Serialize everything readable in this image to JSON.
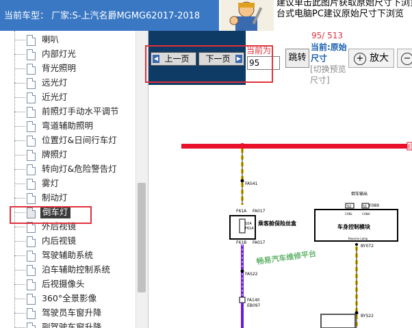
{
  "header": {
    "vehicle_model": "当前车型： 厂家:S-上汽名爵MGMG62017-2018",
    "promo_line1": "建议单击此图片获取原始尺寸下浏览",
    "promo_line2": "台式电脑PC建议原始尺寸下浏览"
  },
  "sidebar": {
    "items": [
      {
        "label": "喇叭"
      },
      {
        "label": "内部灯光"
      },
      {
        "label": "背光照明"
      },
      {
        "label": "远光灯"
      },
      {
        "label": "近光灯"
      },
      {
        "label": "前照灯手动水平调节"
      },
      {
        "label": "弯道辅助照明"
      },
      {
        "label": "位置灯&日间行车灯"
      },
      {
        "label": "牌照灯"
      },
      {
        "label": "转向灯&危险警告灯"
      },
      {
        "label": "雾灯"
      },
      {
        "label": "制动灯"
      },
      {
        "label": "倒车灯"
      },
      {
        "label": "外后视镜"
      },
      {
        "label": "内后视镜"
      },
      {
        "label": "驾驶辅助系统"
      },
      {
        "label": "泊车辅助控制系统"
      },
      {
        "label": "后视摄像头"
      },
      {
        "label": "360°全景影像"
      },
      {
        "label": "驾驶员车窗升降"
      },
      {
        "label": "副驾驶车窗升降"
      }
    ],
    "selected_index": 12
  },
  "toolbar": {
    "prev_label": "上一页",
    "next_label": "下一页",
    "current_page_label": "当前为",
    "current_page_value": "95",
    "jump_label": "跳转",
    "page_count": "95/ 513",
    "size_title": "当前:原始尺寸",
    "size_switch": "[切换预览尺寸]",
    "zoom_in_label": "放大",
    "zoom_in_icon": "zoom-in-icon",
    "zoom_out_icon": "zoom-out-icon"
  },
  "diagram": {
    "labels": {
      "fas41": "FAS41",
      "fa017_top": "FA017",
      "fa017_bottom": "FA017",
      "f61a": "F61A",
      "f61b": "F61B",
      "fuse_box": "乘客舱保险丝盒",
      "fuse_value_1": "10A",
      "fuse_value_2": "F61A",
      "fas22": "FAS22",
      "fa140": "FA140",
      "eb097": "EB097",
      "bcm_title": "车身控制模块",
      "bcm_header": "倒车输出",
      "by089": "BY089",
      "pin_52": "52",
      "pin_s1": "S1",
      "can_l": "CANL",
      "can_h": "CANH",
      "reverse_label": "Reverse Lamp",
      "by072": "BY072",
      "bys22": "BYS22",
      "watermark": "畅易汽车维修平台",
      "side_marker": "E"
    }
  },
  "colors": {
    "header_blue": "#3a78c4",
    "toolbar_navy": "#0e3a66",
    "highlight_red": "#e0303a",
    "power_bus_red": "#e8102a",
    "wire_yellow": "#f2c200",
    "wire_purple": "#6a1bd6",
    "watermark_green": "#2f9a3a"
  }
}
